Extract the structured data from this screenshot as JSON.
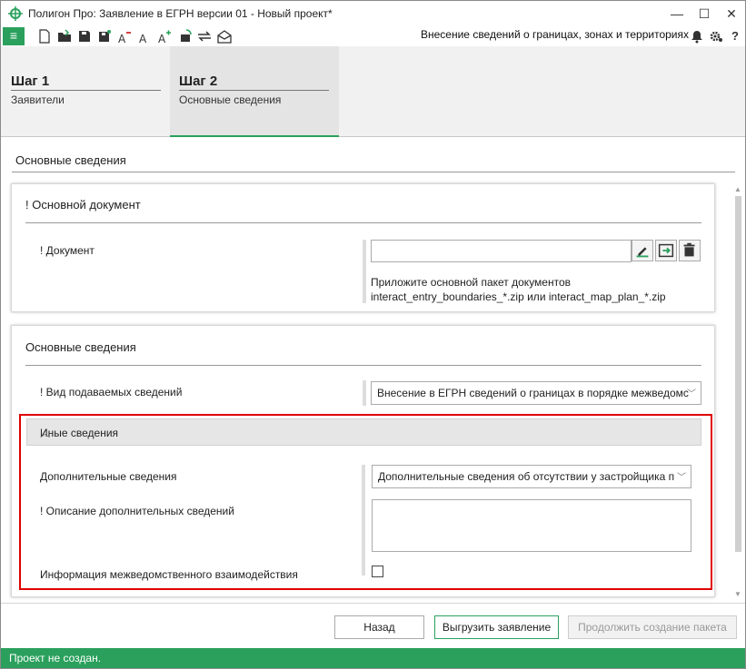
{
  "window": {
    "title": "Полигон Про: Заявление в ЕГРН версии 01 - Новый проект*",
    "minimize": "—",
    "maximize": "☐",
    "close": "✕"
  },
  "toolbar": {
    "menu_icon": "≡",
    "context_title": "Внесение сведений о границах, зонах и территориях",
    "icons": [
      "new-file-icon",
      "open-folder-icon",
      "save-icon",
      "save-as-icon",
      "font-decrease-icon",
      "font-normal-icon",
      "font-increase-icon",
      "update-icon",
      "transfer-icon",
      "mail-icon"
    ],
    "right_icons": [
      "bell-icon",
      "gear-icon",
      "help-icon"
    ],
    "help_label": "?"
  },
  "steps": [
    {
      "number": "Шаг 1",
      "label": "Заявители",
      "active": false
    },
    {
      "number": "Шаг 2",
      "label": "Основные сведения",
      "active": true
    }
  ],
  "main": {
    "section_title": "Основные сведения",
    "document_card": {
      "title": "! Основной документ",
      "document_label": "! Документ",
      "document_value": "",
      "hint_line1": "Приложите основной пакет документов",
      "hint_line2": "interact_entry_boundaries_*.zip или interact_map_plan_*.zip"
    },
    "info_card": {
      "title": "Основные сведения",
      "kind_label": "! Вид подаваемых сведений",
      "kind_value": "Внесение в ЕГРН сведений о границах в порядке межведомс",
      "other": {
        "header": "Иные сведения",
        "additional_label": "Дополнительные сведения",
        "additional_value": "Дополнительные сведения об отсутствии у застройщика п",
        "description_label": "! Описание дополнительных сведений",
        "description_value": "",
        "interagency_label": "Информация межведомственного взаимодействия",
        "interagency_checked": false
      }
    }
  },
  "footer": {
    "back_label": "Назад",
    "export_label": "Выгрузить заявление",
    "continue_label": "Продолжить создание пакета"
  },
  "status": {
    "text": "Проект не создан."
  },
  "colors": {
    "accent": "#2aa05c",
    "highlight": "#e00000"
  }
}
